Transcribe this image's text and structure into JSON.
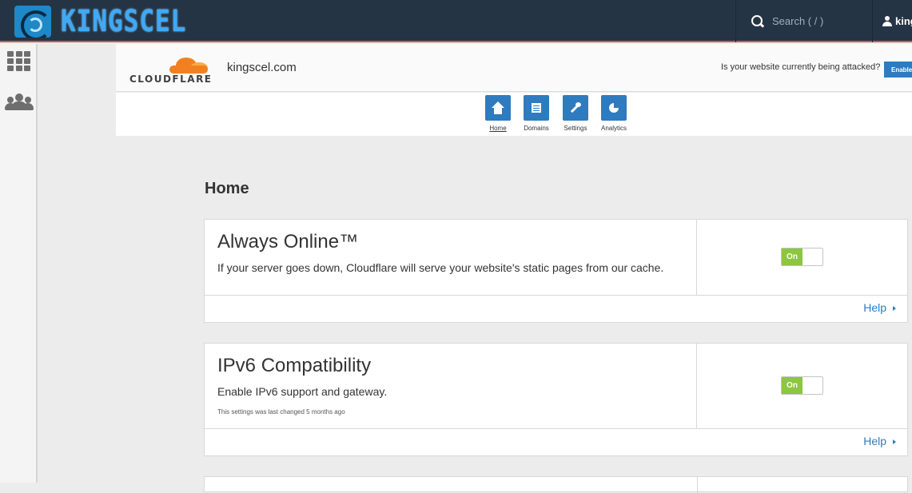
{
  "topbar": {
    "logo_text": "KINGSCEL",
    "search": {
      "placeholder": "Search ( / )",
      "icon": "search-icon"
    },
    "user": {
      "label": "king",
      "icon": "user-icon"
    },
    "accent_color": "#d9534f",
    "background_color": "#253445"
  },
  "rail": {
    "items": [
      {
        "icon": "apps-grid-icon"
      },
      {
        "icon": "users-group-icon"
      }
    ]
  },
  "cloudflare": {
    "brand": "CLOUDFLARE",
    "domain": "kingscel.com",
    "attack_question": "Is your website currently being attacked?",
    "enable_button": "Enable",
    "nav": [
      {
        "label": "Home",
        "icon": "home-icon",
        "active": true
      },
      {
        "label": "Domains",
        "icon": "domains-icon",
        "active": false
      },
      {
        "label": "Settings",
        "icon": "settings-icon",
        "active": false
      },
      {
        "label": "Analytics",
        "icon": "analytics-icon",
        "active": false
      }
    ],
    "brand_color": "#f38020",
    "nav_color": "#2f7bbf"
  },
  "page": {
    "title": "Home",
    "cards": [
      {
        "title": "Always Online™",
        "description": "If your server goes down, Cloudflare will serve your website's static pages from our cache.",
        "meta": "",
        "toggle": "On",
        "help": "Help"
      },
      {
        "title": "IPv6 Compatibility",
        "description": "Enable IPv6 support and gateway.",
        "meta": "This settings was last changed 5 months ago",
        "toggle": "On",
        "help": "Help"
      }
    ],
    "toggle_on_color": "#8dc63f"
  }
}
